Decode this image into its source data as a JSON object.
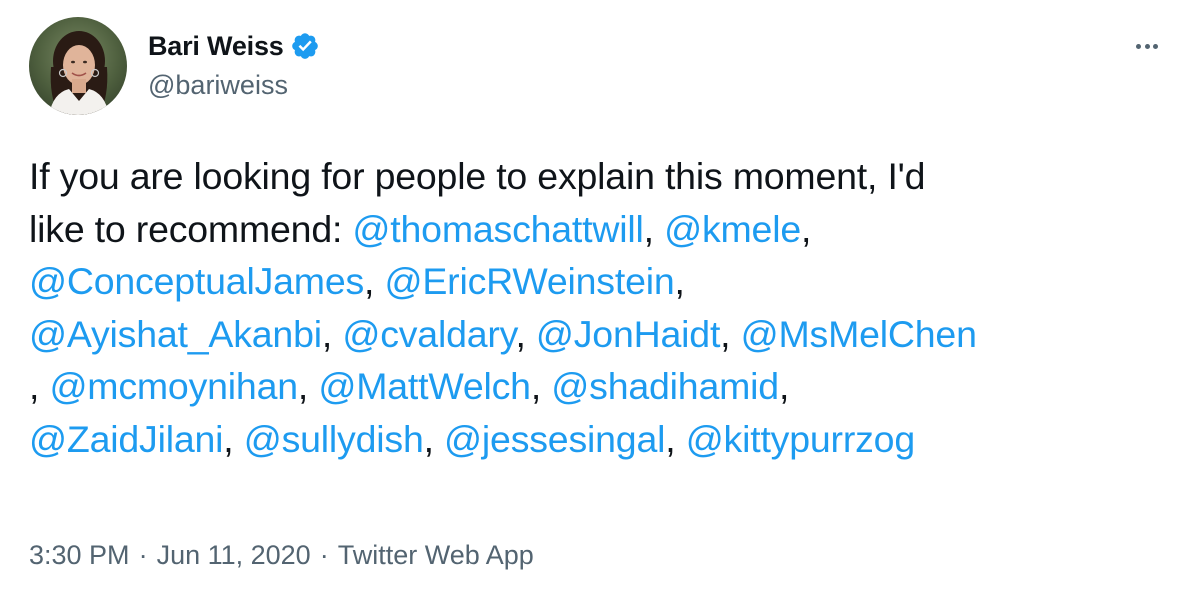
{
  "author": {
    "display_name": "Bari Weiss",
    "handle": "@bariweiss",
    "verified": true,
    "verified_icon": "verified-badge-icon",
    "avatar_icon": "profile-photo"
  },
  "more_icon": "more-options-icon",
  "tweet": {
    "segments": [
      {
        "type": "text",
        "value": "If you are looking for people to explain this moment, I'd"
      },
      {
        "type": "br"
      },
      {
        "type": "text",
        "value": "like to recommend: "
      },
      {
        "type": "mention",
        "value": "@thomaschattwill"
      },
      {
        "type": "text",
        "value": ", "
      },
      {
        "type": "mention",
        "value": "@kmele"
      },
      {
        "type": "text",
        "value": ","
      },
      {
        "type": "br"
      },
      {
        "type": "mention",
        "value": "@ConceptualJames"
      },
      {
        "type": "text",
        "value": ", "
      },
      {
        "type": "mention",
        "value": "@EricRWeinstein"
      },
      {
        "type": "text",
        "value": ","
      },
      {
        "type": "br"
      },
      {
        "type": "mention",
        "value": "@Ayishat_Akanbi"
      },
      {
        "type": "text",
        "value": ", "
      },
      {
        "type": "mention",
        "value": "@cvaldary"
      },
      {
        "type": "text",
        "value": ", "
      },
      {
        "type": "mention",
        "value": "@JonHaidt"
      },
      {
        "type": "text",
        "value": ", "
      },
      {
        "type": "mention",
        "value": "@MsMelChen"
      },
      {
        "type": "br"
      },
      {
        "type": "text",
        "value": ", "
      },
      {
        "type": "mention",
        "value": "@mcmoynihan"
      },
      {
        "type": "text",
        "value": ", "
      },
      {
        "type": "mention",
        "value": "@MattWelch"
      },
      {
        "type": "text",
        "value": ", "
      },
      {
        "type": "mention",
        "value": "@shadihamid"
      },
      {
        "type": "text",
        "value": ","
      },
      {
        "type": "br"
      },
      {
        "type": "mention",
        "value": "@ZaidJilani"
      },
      {
        "type": "text",
        "value": ", "
      },
      {
        "type": "mention",
        "value": "@sullydish"
      },
      {
        "type": "text",
        "value": ", "
      },
      {
        "type": "mention",
        "value": "@jessesingal"
      },
      {
        "type": "text",
        "value": ", "
      },
      {
        "type": "mention",
        "value": "@kittypurrzog"
      }
    ]
  },
  "meta": {
    "time": "3:30 PM",
    "separator": "·",
    "date": "Jun 11, 2020",
    "source": "Twitter Web App"
  },
  "colors": {
    "link": "#1d9bf0",
    "text": "#0f1419",
    "secondary": "#536471",
    "verified": "#1d9bf0",
    "background": "#ffffff"
  }
}
